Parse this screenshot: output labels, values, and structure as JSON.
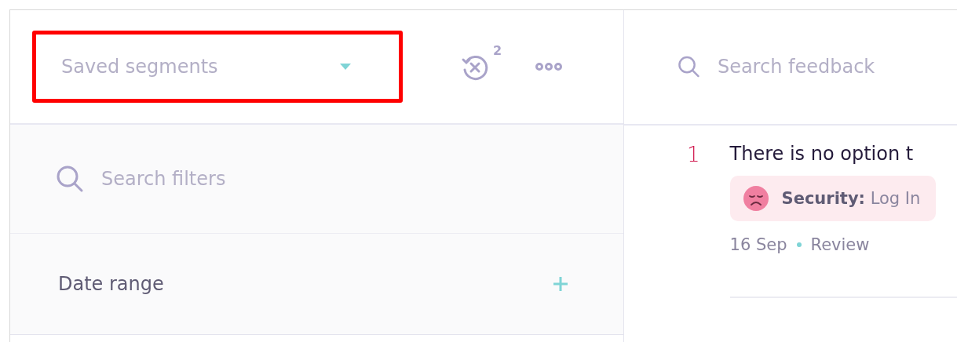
{
  "segments": {
    "placeholder": "Saved segments",
    "highlighted": true
  },
  "history": {
    "badge": "2"
  },
  "filter_search": {
    "placeholder": "Search filters"
  },
  "filters": [
    {
      "label": "Date range"
    }
  ],
  "feedback_search": {
    "placeholder": "Search feedback"
  },
  "feedback": [
    {
      "rank": "1",
      "text": "There is no option t",
      "tag": {
        "category": "Security:",
        "value": "Log In"
      },
      "date": "16 Sep",
      "status": "Review"
    }
  ]
}
